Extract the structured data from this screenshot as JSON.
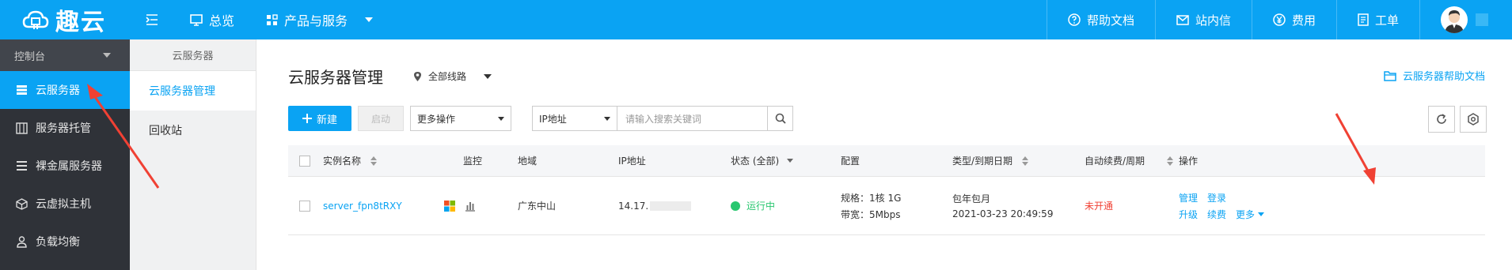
{
  "brand": {
    "name": "趣云"
  },
  "topnav": {
    "overview": "总览",
    "products": "产品与服务",
    "help_docs": "帮助文档",
    "messages": "站内信",
    "billing": "费用",
    "tickets": "工单"
  },
  "sidebar": {
    "header": "控制台",
    "items": [
      {
        "label": "云服务器",
        "icon": "server-list-icon",
        "active": true
      },
      {
        "label": "服务器托管",
        "icon": "hosting-icon"
      },
      {
        "label": "裸金属服务器",
        "icon": "bare-metal-icon"
      },
      {
        "label": "云虚拟主机",
        "icon": "cube-icon"
      },
      {
        "label": "负载均衡",
        "icon": "load-balance-icon"
      }
    ]
  },
  "subnav": {
    "header": "云服务器",
    "items": [
      {
        "label": "云服务器管理",
        "active": true
      },
      {
        "label": "回收站"
      }
    ]
  },
  "page": {
    "title": "云服务器管理",
    "region": "全部线路",
    "help_link": "云服务器帮助文档"
  },
  "toolbar": {
    "new_button": "新建",
    "start_button": "启动",
    "more_ops": "更多操作",
    "search_field": "IP地址",
    "search_placeholder": "请输入搜索关键词"
  },
  "table": {
    "headers": {
      "name": "实例名称",
      "monitor": "监控",
      "region": "地域",
      "ip": "IP地址",
      "status": "状态 (全部)",
      "config": "配置",
      "type_expiry": "类型/到期日期",
      "auto_renew": "自动续费/周期",
      "actions": "操作"
    },
    "rows": [
      {
        "name": "server_fpn8tRXY",
        "region": "广东中山",
        "ip_prefix": "14.17.",
        "status": "运行中",
        "spec": "规格：1核 1G",
        "bandwidth": "带宽：5Mbps",
        "billing_type": "包年包月",
        "expiry": "2021-03-23 20:49:59",
        "auto_renew": "未开通",
        "actions": {
          "manage": "管理",
          "login": "登录",
          "upgrade": "升级",
          "renew": "续费",
          "more": "更多"
        }
      }
    ]
  },
  "colors": {
    "accent": "#0aa3f3",
    "sidebar_bg": "#2f3238",
    "running": "#28c76f",
    "warning": "#f04134",
    "annotation": "#f04134"
  }
}
